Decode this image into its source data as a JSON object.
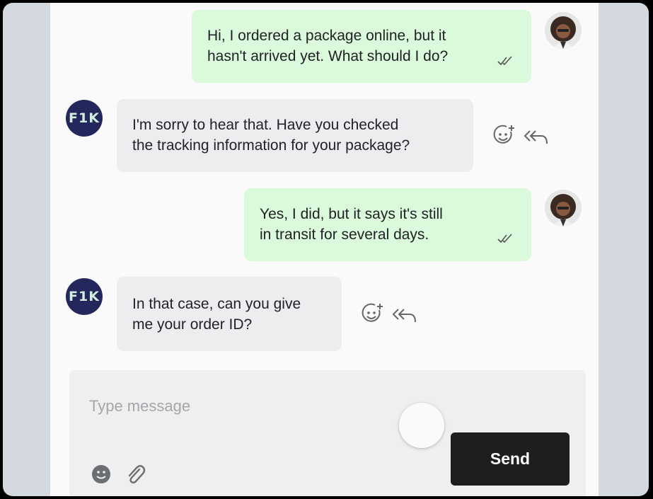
{
  "messages": [
    {
      "direction": "outgoing",
      "lines": [
        "Hi, I ordered a package online, but it",
        "hasn't arrived yet. What should I do?"
      ],
      "status_icon": "double-check-icon"
    },
    {
      "direction": "incoming",
      "sender_avatar": "F1K",
      "lines": [
        "I'm sorry to hear that. Have you checked",
        "the tracking information for your package?"
      ],
      "actions": [
        "add-reaction-icon",
        "reply-all-icon"
      ]
    },
    {
      "direction": "outgoing",
      "lines": [
        "Yes, I did, but it says it's still",
        "in transit for several days."
      ],
      "status_icon": "double-check-icon"
    },
    {
      "direction": "incoming",
      "sender_avatar": "F1K",
      "lines": [
        "In that case, can you give",
        "me your order ID?"
      ],
      "actions": [
        "add-reaction-icon",
        "reply-all-icon"
      ]
    }
  ],
  "composer": {
    "placeholder": "Type message",
    "value": "",
    "send_label": "Send",
    "icons": [
      "smiley-icon",
      "paperclip-icon"
    ]
  },
  "colors": {
    "outgoing_bubble": "#dbfadb",
    "incoming_bubble": "#ededef",
    "brand_avatar": "#23275c",
    "send_button": "#1c1e20"
  }
}
